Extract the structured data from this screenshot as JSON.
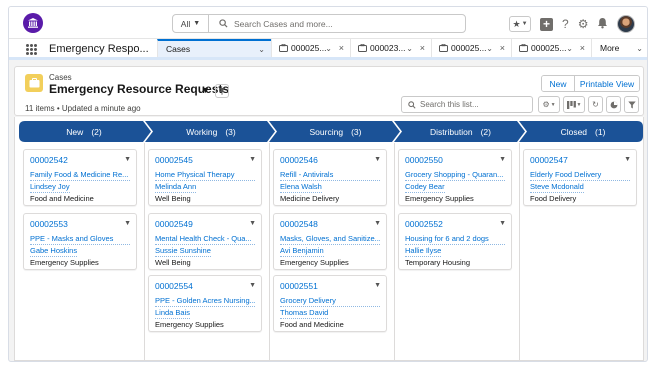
{
  "search": {
    "scope": "All",
    "placeholder": "Search Cases and more..."
  },
  "nav": {
    "app_name": "Emergency Respo...",
    "tabs": [
      {
        "label": "Cases"
      },
      {
        "label": "000025..."
      },
      {
        "label": "000023..."
      },
      {
        "label": "000025..."
      },
      {
        "label": "000025..."
      }
    ],
    "more": "More"
  },
  "page_header": {
    "object_label": "Cases",
    "title": "Emergency Resource Requests",
    "meta": "11 items • Updated a minute ago",
    "new_button": "New",
    "print_button": "Printable View",
    "search_placeholder": "Search this list..."
  },
  "colors": {
    "brand": "#5a1ba9",
    "stage": "#1b5297",
    "link": "#0070d2",
    "case_icon": "#f2cf5b"
  },
  "stages": [
    {
      "name": "New",
      "count": "(2)",
      "cards": [
        {
          "number": "00002542",
          "subject": "Family Food & Medicine Re...",
          "contact": "Lindsey Joy",
          "type": "Food and Medicine"
        },
        {
          "number": "00002553",
          "subject": "PPE - Masks and Gloves",
          "contact": "Gabe Hoskins",
          "type": "Emergency Supplies"
        }
      ]
    },
    {
      "name": "Working",
      "count": "(3)",
      "cards": [
        {
          "number": "00002545",
          "subject": "Home Physical Therapy",
          "contact": "Melinda Ann",
          "type": "Well Being"
        },
        {
          "number": "00002549",
          "subject": "Mental Health Check - Qua...",
          "contact": "Sussie Sunshine",
          "type": "Well Being"
        },
        {
          "number": "00002554",
          "subject": "PPE - Golden Acres Nursing...",
          "contact": "Linda Bais",
          "type": "Emergency Supplies"
        }
      ]
    },
    {
      "name": "Sourcing",
      "count": "(3)",
      "cards": [
        {
          "number": "00002546",
          "subject": "Refill - Antivirals",
          "contact": "Elena Walsh",
          "type": "Medicine Delivery"
        },
        {
          "number": "00002548",
          "subject": "Masks, Gloves, and Sanitize...",
          "contact": "Avi Benjamin",
          "type": "Emergency Supplies"
        },
        {
          "number": "00002551",
          "subject": "Grocery Delivery",
          "contact": "Thomas David",
          "type": "Food and Medicine"
        }
      ]
    },
    {
      "name": "Distribution",
      "count": "(2)",
      "cards": [
        {
          "number": "00002550",
          "subject": "Grocery Shopping - Quaran...",
          "contact": "Codey Bear",
          "type": "Emergency Supplies"
        },
        {
          "number": "00002552",
          "subject": "Housing for 6 and 2 dogs",
          "contact": "Hallie Ilyse",
          "type": "Temporary Housing"
        }
      ]
    },
    {
      "name": "Closed",
      "count": "(1)",
      "cards": [
        {
          "number": "00002547",
          "subject": "Elderly Food Delivery",
          "contact": "Steve Mcdonald",
          "type": "Food Delivery"
        }
      ]
    }
  ]
}
